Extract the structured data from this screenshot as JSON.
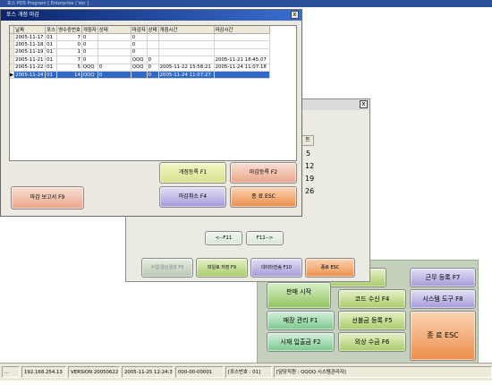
{
  "topbar": {
    "text": "포스 POS Program [ Enterprise / Ver ]"
  },
  "dialog": {
    "title": "포스 개점 마감",
    "close": "x",
    "columns": [
      "날짜",
      "포스",
      "영수증번호",
      "개점자",
      "상태",
      "마감자",
      "상태",
      "개점시간",
      "마감시간"
    ],
    "rows": [
      [
        "2005-11-17",
        "01",
        "7",
        "0",
        "",
        "0",
        "",
        "",
        ""
      ],
      [
        "2005-11-18",
        "01",
        "0",
        "0",
        "",
        "0",
        "",
        "",
        ""
      ],
      [
        "2005-11-19",
        "01",
        "1",
        "0",
        "",
        "0",
        "",
        "",
        ""
      ],
      [
        "2005-11-21",
        "01",
        "7",
        "0",
        "",
        "QQQ",
        "0",
        "",
        "2005-11-21 18:45:07"
      ],
      [
        "2005-11-22",
        "01",
        "5",
        "QQQ",
        "0",
        "QQQ",
        "0",
        "2005-11-22 15:58:21",
        "2005-11-24 11:07:18"
      ],
      [
        "2005-11-24",
        "01",
        "14",
        "QQQ",
        "0",
        "",
        "0",
        "2005-11-24 11:07:27",
        ""
      ]
    ],
    "buttons": {
      "open": "개점등록 F1",
      "close_reg": "마감등록 F2",
      "cancel": "마감취소 F4",
      "exit": "종 료 ESC",
      "report": "마감 보고서   F9"
    }
  },
  "mid": {
    "close": "x",
    "header_cell": "트",
    "numbers": [
      "5",
      "12",
      "19",
      "26"
    ],
    "prev": "<--F11",
    "next": "F12-->",
    "bottom_buttons": [
      "수업/결산결과 F5",
      "파일로 저장 F9",
      "데이터전송 F10",
      "종료 ESC"
    ]
  },
  "menu": {
    "close_f3": "마감 F3",
    "work_reg": "근무 등록 F7",
    "sales_start": "판매 시작",
    "code_recv": "코드 수신 F4",
    "sys_tool": "시스템 도구 F8",
    "store_mgmt": "매장 관리 F1",
    "prepaid_reg": "선불금 등록 F5",
    "exit": "종 료 ESC",
    "deposit": "시재 입출금 F2",
    "ar_collect": "외상 수금 F6"
  },
  "status": {
    "dots": "...",
    "ip": "192.168.254.13",
    "version": "VERSION 20050622",
    "datetime": "2005-11-25 12:24:37",
    "code": "000-00-00001",
    "pos": "[포스번호 : 01]",
    "manager": "[담당직원 : QQQQ 시스템관리자]"
  }
}
